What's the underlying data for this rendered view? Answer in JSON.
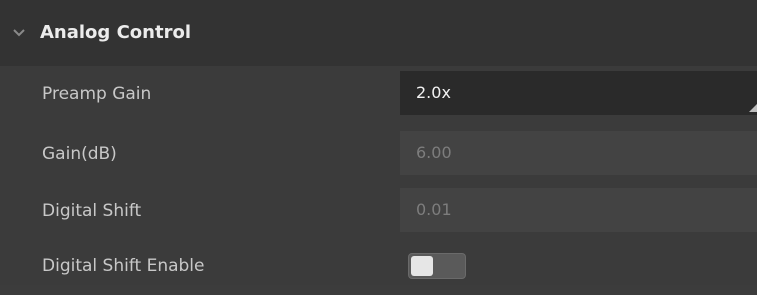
{
  "section": {
    "title": "Analog Control",
    "expanded": true,
    "icon": "chevron-down-icon"
  },
  "rows": [
    {
      "label": "Preamp Gain",
      "value": "2.0x",
      "type": "dropdown",
      "enabled": true
    },
    {
      "label": "Gain(dB)",
      "value": "6.00",
      "type": "number",
      "enabled": false
    },
    {
      "label": "Digital Shift",
      "value": "0.01",
      "type": "number",
      "enabled": false
    },
    {
      "label": "Digital Shift Enable",
      "type": "toggle",
      "state": "off"
    }
  ],
  "colors": {
    "header_bg": "#333333",
    "panel_bg": "#3b3b3b",
    "active_field_bg": "#2a2a2a",
    "disabled_field_bg": "#434343"
  }
}
